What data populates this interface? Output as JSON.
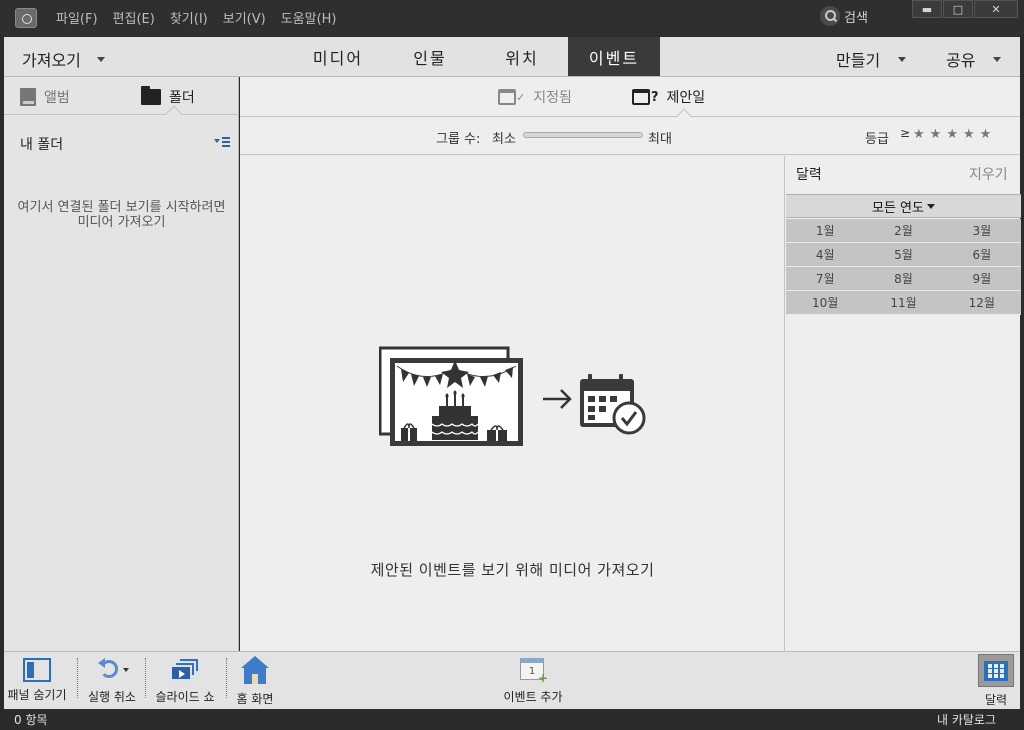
{
  "menu": [
    "파일(F)",
    "편집(E)",
    "찾기(I)",
    "보기(V)",
    "도움말(H)"
  ],
  "search_label": "검색",
  "window_controls": {
    "minimize": "▬",
    "maximize": "□",
    "close": "✕"
  },
  "nav": {
    "import_label": "가져오기",
    "tabs": [
      "미디어",
      "인물",
      "위치",
      "이벤트"
    ],
    "active_tab": "이벤트",
    "create_label": "만들기",
    "share_label": "공유"
  },
  "left_panel": {
    "album_tab": "앨범",
    "folder_tab": "폴더",
    "section_title": "내 폴더",
    "message": "여기서 연결된 폴더 보기를 시작하려면미디어 가져오기"
  },
  "view_tabs": {
    "named": "지정됨",
    "suggested": "제안일"
  },
  "filter": {
    "group_label": "그룹 수:",
    "min_label": "최소",
    "max_label": "최대",
    "rating_label": "등급",
    "rating_ge": "≥",
    "stars": [
      "★",
      "★",
      "★",
      "★",
      "★"
    ]
  },
  "empty_message": "제안된 이벤트를 보기 위해 미디어 가져오기",
  "calendar": {
    "title": "달력",
    "clear_label": "지우기",
    "year_label": "모든 연도",
    "months": [
      [
        "1월",
        "2월",
        "3월"
      ],
      [
        "4월",
        "5월",
        "6월"
      ],
      [
        "7월",
        "8월",
        "9월"
      ],
      [
        "10월",
        "11월",
        "12월"
      ]
    ]
  },
  "toolbar": {
    "hide_panel": "패널 숨기기",
    "undo": "실행 취소",
    "slideshow": "슬라이드 쇼",
    "home": "홈 화면",
    "add_event": "이벤트 추가",
    "add_event_icon_number": "1",
    "calendar": "달력"
  },
  "status": {
    "items": "0 항목",
    "catalog": "내 카탈로그"
  },
  "colors": {
    "accent_blue": "#2a6fb8",
    "active_tab_bg": "#3a3a3a",
    "title_bar": "#2f2f2f"
  }
}
